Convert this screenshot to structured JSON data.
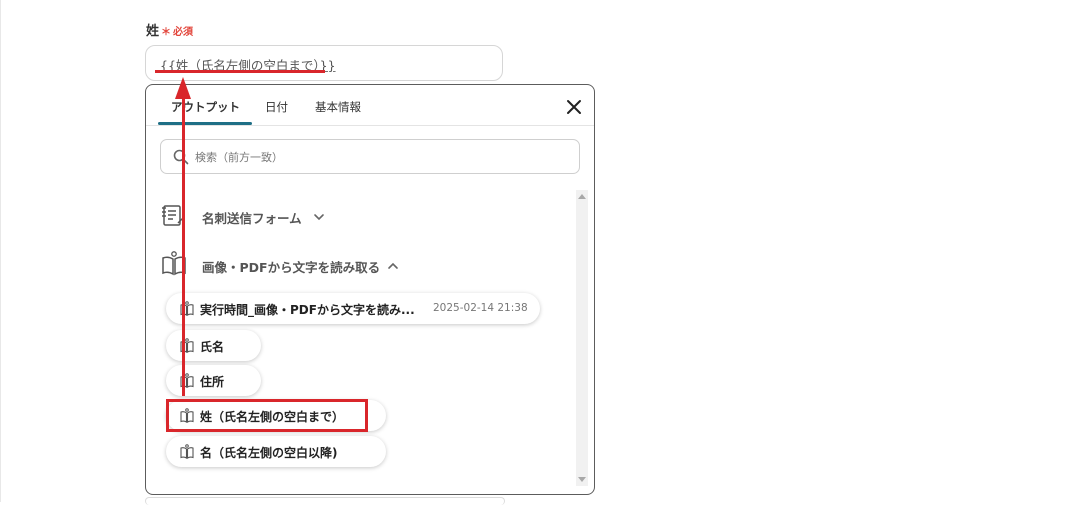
{
  "field": {
    "label": "姓",
    "required_mark": "＊",
    "required_text": "必須",
    "value": "{{姓（氏名左側の空白まで）}}"
  },
  "panel": {
    "tabs": [
      {
        "label": "アウトプット",
        "active": true
      },
      {
        "label": "日付",
        "active": false
      },
      {
        "label": "基本情報",
        "active": false
      }
    ],
    "close_icon": "close-icon",
    "search": {
      "placeholder": "検索（前方一致）",
      "value": ""
    },
    "groups": [
      {
        "title": "名刺送信フォーム",
        "icon": "form-icon",
        "expanded": false
      },
      {
        "title": "画像・PDFから文字を読み取る",
        "icon": "book-icon",
        "expanded": true
      }
    ],
    "items": [
      {
        "label": "実行時間_画像・PDFから文字を読み...",
        "meta": "2025-02-14 21:38"
      },
      {
        "label": "氏名",
        "meta": ""
      },
      {
        "label": "住所",
        "meta": ""
      },
      {
        "label": "姓（氏名左側の空白まで）",
        "meta": "",
        "highlighted": true
      },
      {
        "label": "名（氏名左側の空白以降)",
        "meta": ""
      }
    ]
  },
  "colors": {
    "accent": "#1f6f86",
    "annotation": "#d9262b",
    "required": "#e2463c"
  }
}
